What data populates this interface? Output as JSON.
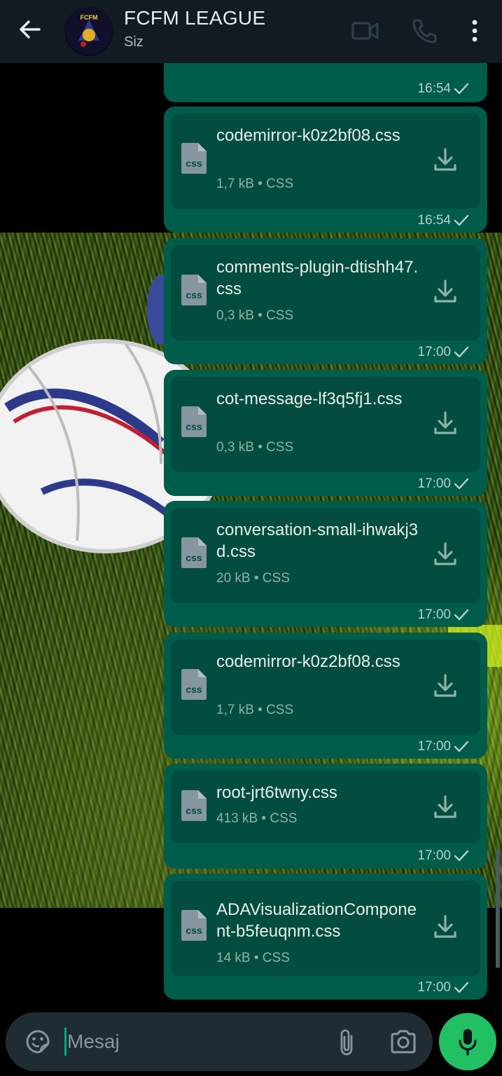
{
  "header": {
    "title": "FCFM LEAGUE",
    "subtitle": "Siz",
    "avatar_text": "FCFM"
  },
  "icons": {
    "back": "arrow-back-icon",
    "video": "video-call-icon",
    "voice": "voice-call-icon",
    "menu": "more-vert-icon",
    "file": "css-file-icon",
    "download": "download-icon",
    "check": "sent-check-icon",
    "emoji": "sticker-icon",
    "attach": "paperclip-icon",
    "camera": "camera-icon",
    "mic": "mic-icon"
  },
  "colors": {
    "header_bg": "#121b22",
    "bubble_bg": "#005c4b",
    "card_bg": "#024d3f",
    "accent": "#00a884",
    "mic_bg": "#21c063"
  },
  "file_icon_label": "css",
  "messages": [
    {
      "time": "16:54"
    },
    {
      "file_name": "codemirror-k0z2bf08.css",
      "meta": "1,7 kB • CSS",
      "time": "16:54"
    },
    {
      "file_name": "comments-plugin-dtishh47.css",
      "meta": "0,3 kB • CSS",
      "time": "17:00"
    },
    {
      "file_name": "cot-message-lf3q5fj1.css",
      "meta": "0,3 kB • CSS",
      "time": "17:00"
    },
    {
      "file_name": "conversation-small-ihwakj3d.css",
      "meta": "20 kB • CSS",
      "time": "17:00"
    },
    {
      "file_name": "codemirror-k0z2bf08.css",
      "meta": "1,7 kB • CSS",
      "time": "17:00"
    },
    {
      "file_name": "root-jrt6twny.css",
      "meta": "413 kB • CSS",
      "time": "17:00"
    },
    {
      "file_name": "ADAVisualizationComponent-b5feuqnm.css",
      "meta": "14 kB • CSS",
      "time": "17:00"
    }
  ],
  "composer": {
    "placeholder": "Mesaj",
    "value": ""
  }
}
